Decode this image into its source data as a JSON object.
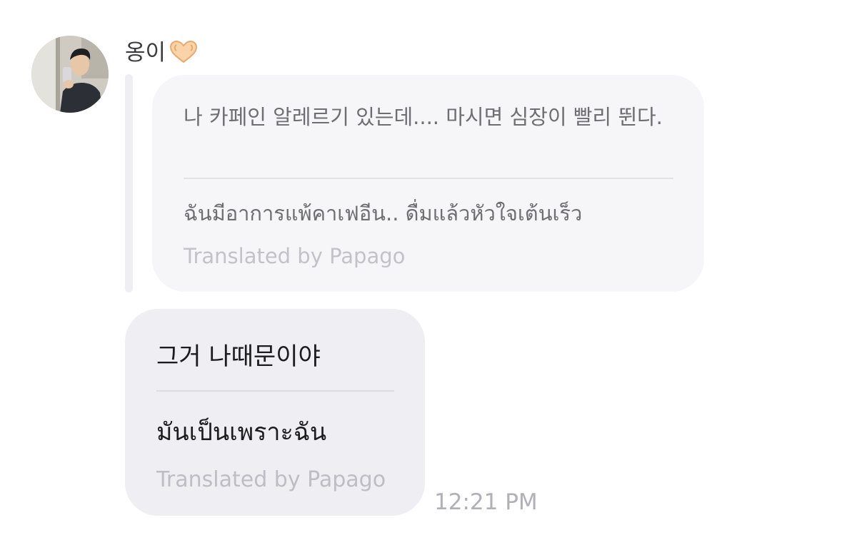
{
  "sender": {
    "name": "옹이",
    "emoji_icon": "heart-hands-icon"
  },
  "quoted_message": {
    "original": "나 카페인 알레르기 있는데.... 마시면 심장이 빨리 뛴다.",
    "translation": "ฉันมีอาการแพ้คาเฟอีน.. ดื่มแล้วหัวใจเต้นเร็ว",
    "credit": "Translated by Papago"
  },
  "message": {
    "original": "그거 나때문이야",
    "translation": "มันเป็นเพราะฉัน",
    "credit": "Translated by Papago",
    "time": "12:21 PM"
  },
  "colors": {
    "quoted_bubble": "#f6f6f9",
    "message_bubble": "#efeff3",
    "reply_bar": "#efeff3",
    "credit_text": "#c2c2c8",
    "timestamp_text": "#b0b0b6"
  }
}
